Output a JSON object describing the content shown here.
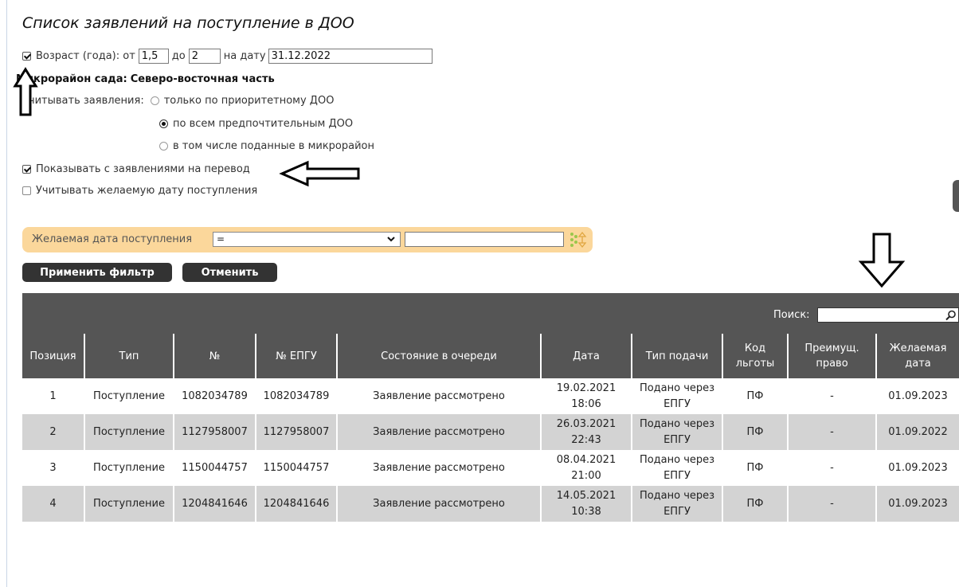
{
  "title": "Список заявлений на поступление в ДОО",
  "age": {
    "checked": true,
    "label": "Возраст (года): от",
    "from_value": "1,5",
    "to_label": "до",
    "to_value": "2",
    "date_label": "на дату",
    "date_value": "31.12.2022"
  },
  "microdistrict": {
    "label": "Микрорайон сада:",
    "value": "Северо-восточная часть"
  },
  "consider": {
    "label": "Учитывать заявления:",
    "options": [
      {
        "label": "только по приоритетному ДОО",
        "checked": false
      },
      {
        "label": "по всем предпочтительным ДОО",
        "checked": true
      },
      {
        "label": "в том числе поданные в микрорайон",
        "checked": false
      }
    ]
  },
  "show_transfer": {
    "label": "Показывать с заявлениями на перевод",
    "checked": true
  },
  "consider_date": {
    "label": "Учитывать желаемую дату поступления",
    "checked": false
  },
  "filter": {
    "field_label": "Желаемая дата поступления",
    "operator": "=",
    "value": ""
  },
  "buttons": {
    "apply": "Применить фильтр",
    "cancel": "Отменить"
  },
  "search": {
    "label": "Поиск:",
    "value": ""
  },
  "table": {
    "headers": [
      "Позиция",
      "Тип",
      "№",
      "№ ЕПГУ",
      "Состояние в очереди",
      "Дата",
      "Тип подачи",
      "Код льготы",
      "Преимущ. право",
      "Желаемая дата"
    ],
    "rows": [
      [
        "1",
        "Поступление",
        "1082034789",
        "1082034789",
        "Заявление рассмотрено",
        "19.02.2021 18:06",
        "Подано через ЕПГУ",
        "ПФ",
        "-",
        "01.09.2023"
      ],
      [
        "2",
        "Поступление",
        "1127958007",
        "1127958007",
        "Заявление рассмотрено",
        "26.03.2021 22:43",
        "Подано через ЕПГУ",
        "ПФ",
        "-",
        "01.09.2022"
      ],
      [
        "3",
        "Поступление",
        "1150044757",
        "1150044757",
        "Заявление рассмотрено",
        "08.04.2021 21:00",
        "Подано через ЕПГУ",
        "ПФ",
        "-",
        "01.09.2023"
      ],
      [
        "4",
        "Поступление",
        "1204841646",
        "1204841646",
        "Заявление рассмотрено",
        "14.05.2021 10:38",
        "Подано через ЕПГУ",
        "ПФ",
        "-",
        "01.09.2023"
      ]
    ]
  },
  "colors": {
    "table_header": "#555555",
    "row_alt": "#d3d3d3",
    "filter_bar": "#fbd79b",
    "button": "#333333"
  }
}
